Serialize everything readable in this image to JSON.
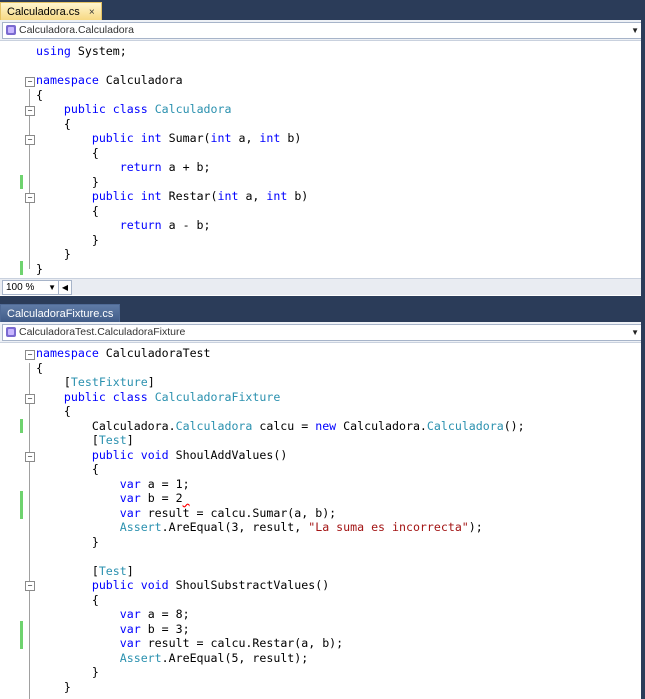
{
  "top": {
    "tab_label": "Calculadora.cs",
    "close_glyph": "×",
    "nav_value": "Calculadora.Calculadora",
    "zoom": "100 %"
  },
  "bottom": {
    "tab_label": "CalculadoraFixture.cs",
    "nav_value": "CalculadoraTest.CalculadoraFixture"
  },
  "glyphs": {
    "dropdown": "▼",
    "scroll_left": "◀",
    "collapse": "−"
  },
  "colors": {
    "keyword": "#0000ff",
    "type": "#2b91af",
    "string": "#a31515",
    "change_marker": "#6fd36f"
  }
}
